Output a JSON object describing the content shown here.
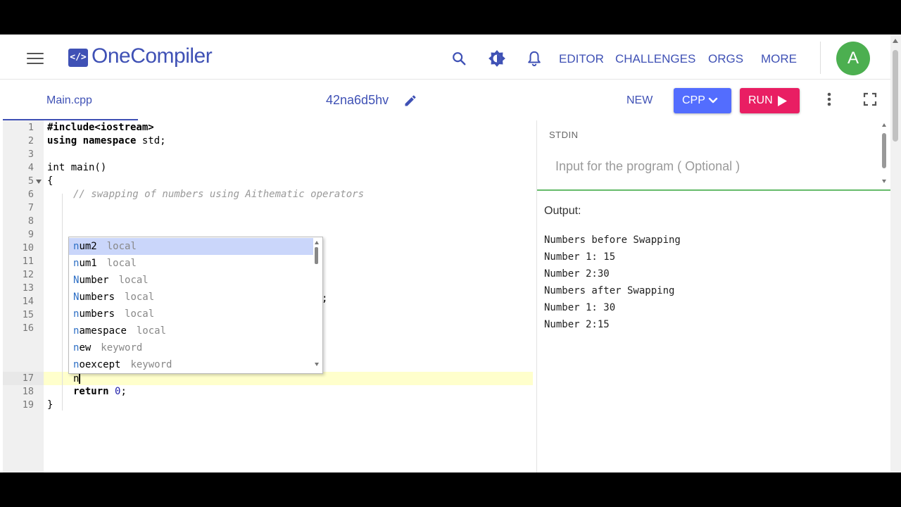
{
  "header": {
    "brand_mark": "</>",
    "brand_name": "OneCompiler",
    "nav": [
      "EDITOR",
      "CHALLENGES",
      "ORGS",
      "MORE"
    ],
    "avatar_letter": "A",
    "icons": [
      "menu-icon",
      "search-icon",
      "theme-toggle-icon",
      "bell-icon"
    ]
  },
  "toolbar": {
    "file_tab": "Main.cpp",
    "project_name": "42na6d5hv",
    "new_label": "NEW",
    "language_label": "CPP",
    "run_label": "RUN"
  },
  "editor": {
    "line_numbers": [
      "1",
      "2",
      "3",
      "4",
      "5",
      "6",
      "7",
      "8",
      "9",
      "10",
      "11",
      "12",
      "13",
      "14",
      "15",
      "16",
      "17",
      "18",
      "19"
    ],
    "lines": {
      "l1": "#include<iostream>",
      "l2_kw": "using namespace",
      "l2_rest": " std;",
      "l4": "int main()",
      "l5": "{",
      "l6": "// swapping of numbers using Aithematic operators",
      "l11_tail": ";",
      "l17": "n",
      "l18_kw": "return",
      "l18_num": "0",
      "l18_end": ";",
      "l19": "}"
    },
    "autocomplete": [
      {
        "match": "n",
        "rest": "um2",
        "meta": "local"
      },
      {
        "match": "n",
        "rest": "um1",
        "meta": "local"
      },
      {
        "match": "N",
        "rest": "umber",
        "meta": "local"
      },
      {
        "match": "N",
        "rest": "umbers",
        "meta": "local"
      },
      {
        "match": "n",
        "rest": "umbers",
        "meta": "local"
      },
      {
        "match": "n",
        "rest": "amespace",
        "meta": "local"
      },
      {
        "match": "n",
        "rest": "ew",
        "meta": "keyword"
      },
      {
        "match": "n",
        "rest": "oexcept",
        "meta": "keyword"
      }
    ]
  },
  "stdin": {
    "label": "STDIN",
    "placeholder": "Input for the program ( Optional )"
  },
  "output": {
    "label": "Output:",
    "lines": [
      "Numbers before Swapping",
      "Number 1: 15",
      "Number 2:30",
      "Numbers after Swapping",
      "Number 1: 30",
      "Number 2:15"
    ]
  },
  "colors": {
    "brand": "#3f51b5",
    "language_button": "#536dfe",
    "run_button": "#e91e63",
    "avatar": "#4caf50",
    "active_line": "#ffffcc"
  }
}
